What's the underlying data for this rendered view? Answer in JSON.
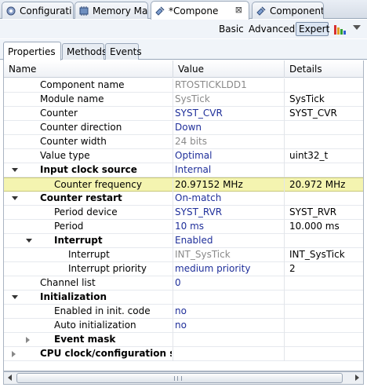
{
  "editor_tabs": [
    {
      "label": "Configurati",
      "icon": "gear-icon"
    },
    {
      "label": "Memory Ma",
      "icon": "memory-icon"
    },
    {
      "label": "*Compone",
      "icon": "component-icon",
      "active": true
    },
    {
      "label": "Component",
      "icon": "component-icon"
    }
  ],
  "toolbar": {
    "basic_label": "Basic",
    "advanced_label": "Advanced",
    "expert_label": "Expert",
    "chart_icon": "bar-chart-icon",
    "menu_icon": "view-menu-icon"
  },
  "sub_tabs": [
    "Properties",
    "Methods",
    "Events"
  ],
  "table": {
    "columns": [
      "Name",
      "Value",
      "Details"
    ],
    "rows": [
      {
        "name": "Component name",
        "value": "RTOSTICKLDD1",
        "details": "",
        "indent": 0,
        "bold": false,
        "value_color": "gray"
      },
      {
        "name": "Module name",
        "value": "SysTick",
        "details": "SysTick",
        "indent": 0,
        "bold": false,
        "value_color": "gray"
      },
      {
        "name": "Counter",
        "value": "SYST_CVR",
        "details": "SYST_CVR",
        "indent": 0,
        "bold": false,
        "value_color": "blue"
      },
      {
        "name": "Counter direction",
        "value": "Down",
        "details": "",
        "indent": 0,
        "bold": false,
        "value_color": "blue"
      },
      {
        "name": "Counter width",
        "value": "24 bits",
        "details": "",
        "indent": 0,
        "bold": false,
        "value_color": "gray"
      },
      {
        "name": "Value type",
        "value": "Optimal",
        "details": "uint32_t",
        "indent": 0,
        "bold": false,
        "value_color": "blue"
      },
      {
        "name": "Input clock source",
        "value": "Internal",
        "details": "",
        "indent": 0,
        "bold": true,
        "value_color": "blue",
        "toggle": "open"
      },
      {
        "name": "Counter frequency",
        "value": "20.97152 MHz",
        "details": "20.972 MHz",
        "indent": 1,
        "bold": false,
        "value_color": "black",
        "selected": true
      },
      {
        "name": "Counter restart",
        "value": "On-match",
        "details": "",
        "indent": 0,
        "bold": true,
        "value_color": "blue",
        "toggle": "open"
      },
      {
        "name": "Period device",
        "value": "SYST_RVR",
        "details": "SYST_RVR",
        "indent": 1,
        "bold": false,
        "value_color": "blue"
      },
      {
        "name": "Period",
        "value": "10 ms",
        "details": "10.000 ms",
        "indent": 1,
        "bold": false,
        "value_color": "blue"
      },
      {
        "name": "Interrupt",
        "value": "Enabled",
        "details": "",
        "indent": 1,
        "bold": true,
        "value_color": "blue",
        "toggle": "open"
      },
      {
        "name": "Interrupt",
        "value": "INT_SysTick",
        "details": "INT_SysTick",
        "indent": 2,
        "bold": false,
        "value_color": "gray"
      },
      {
        "name": "Interrupt priority",
        "value": "medium priority",
        "details": "2",
        "indent": 2,
        "bold": false,
        "value_color": "blue"
      },
      {
        "name": "Channel list",
        "value": "0",
        "details": "",
        "indent": 0,
        "bold": false,
        "value_color": "blue"
      },
      {
        "name": "Initialization",
        "value": "",
        "details": "",
        "indent": 0,
        "bold": true,
        "value_color": "blue",
        "toggle": "open"
      },
      {
        "name": "Enabled in init. code",
        "value": "no",
        "details": "",
        "indent": 1,
        "bold": false,
        "value_color": "blue"
      },
      {
        "name": "Auto initialization",
        "value": "no",
        "details": "",
        "indent": 1,
        "bold": false,
        "value_color": "blue"
      },
      {
        "name": "Event mask",
        "value": "",
        "details": "",
        "indent": 1,
        "bold": true,
        "value_color": "blue",
        "toggle": "closed"
      },
      {
        "name": "CPU clock/configuration selec",
        "value": "",
        "details": "",
        "indent": 0,
        "bold": true,
        "value_color": "blue",
        "toggle": "closed"
      }
    ]
  },
  "colors": {
    "value_blue": "#1f2f9a",
    "value_gray": "#8a8a8a",
    "selected_row": "#f4f4b0"
  }
}
